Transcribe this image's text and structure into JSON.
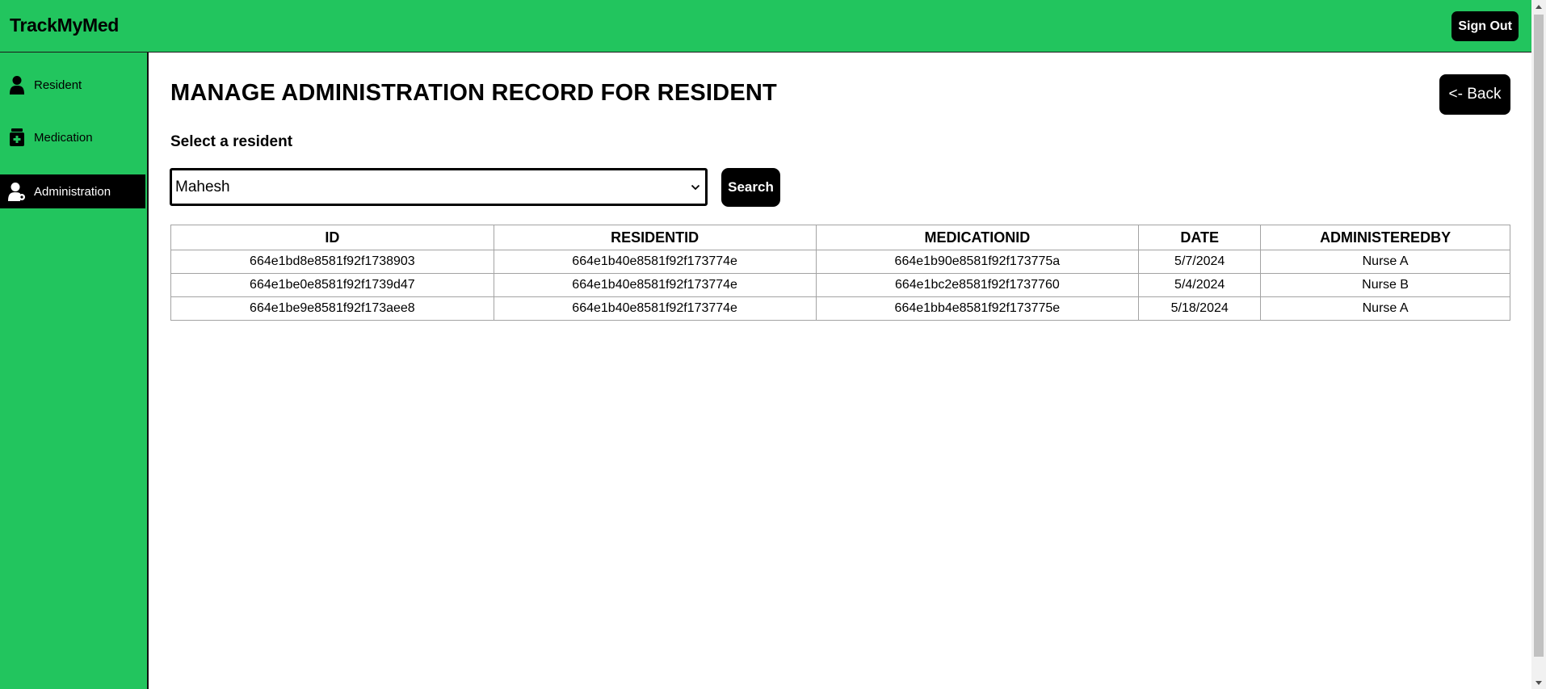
{
  "header": {
    "brand": "TrackMyMed",
    "sign_out_label": "Sign Out",
    "accent_color": "#22c55e"
  },
  "sidebar": {
    "items": [
      {
        "label": "Resident",
        "icon": "person-icon",
        "active": false
      },
      {
        "label": "Medication",
        "icon": "medicine-bottle-icon",
        "active": false
      },
      {
        "label": "Administration",
        "icon": "user-gear-icon",
        "active": true
      }
    ]
  },
  "main": {
    "title": "MANAGE ADMINISTRATION RECORD FOR RESIDENT",
    "back_label": "<- Back",
    "select_label": "Select a resident",
    "selected_resident": "Mahesh",
    "search_label": "Search",
    "table": {
      "columns": [
        "ID",
        "RESIDENTID",
        "MEDICATIONID",
        "DATE",
        "ADMINISTEREDBY"
      ],
      "rows": [
        [
          "664e1bd8e8581f92f1738903",
          "664e1b40e8581f92f173774e",
          "664e1b90e8581f92f173775a",
          "5/7/2024",
          "Nurse A"
        ],
        [
          "664e1be0e8581f92f1739d47",
          "664e1b40e8581f92f173774e",
          "664e1bc2e8581f92f1737760",
          "5/4/2024",
          "Nurse B"
        ],
        [
          "664e1be9e8581f92f173aee8",
          "664e1b40e8581f92f173774e",
          "664e1bb4e8581f92f173775e",
          "5/18/2024",
          "Nurse A"
        ]
      ]
    }
  }
}
